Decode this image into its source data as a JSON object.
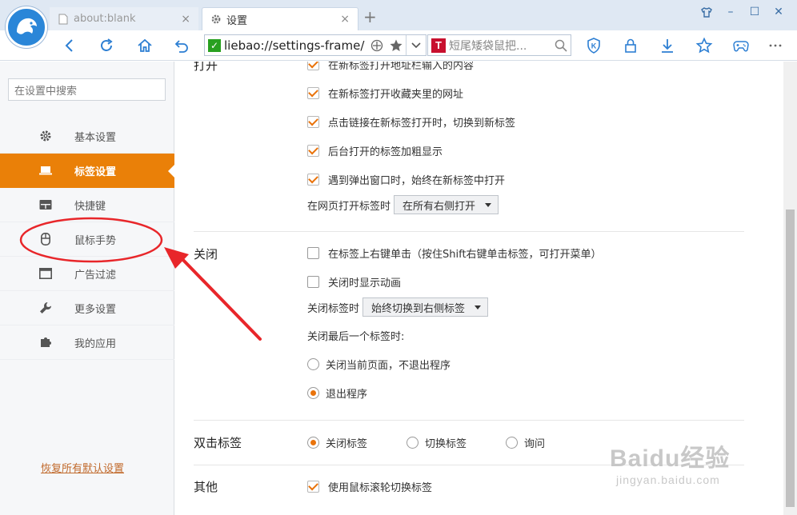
{
  "browser": {
    "tabs": [
      {
        "title": "about:blank",
        "close": "×"
      },
      {
        "title": "设置",
        "close": "×"
      }
    ],
    "new_tab": "+",
    "window_controls": [
      "shirt-icon",
      "minimize",
      "maximize",
      "close"
    ],
    "window_control_glyphs": [
      "",
      "–",
      "☐",
      "✕"
    ],
    "address": {
      "url": "liebao://settings-frame/",
      "secure_glyph": "✓"
    },
    "search": {
      "engine_letter": "T",
      "query": "短尾矮袋鼠把..."
    }
  },
  "sidebar": {
    "search_placeholder": "在设置中搜索",
    "items": [
      {
        "label": "基本设置",
        "icon": "gear-icon"
      },
      {
        "label": "标签设置",
        "icon": "laptop-icon",
        "active": true
      },
      {
        "label": "快捷键",
        "icon": "keyboard-icon"
      },
      {
        "label": "鼠标手势",
        "icon": "mouse-icon"
      },
      {
        "label": "广告过滤",
        "icon": "window-icon"
      },
      {
        "label": "更多设置",
        "icon": "wrench-icon"
      },
      {
        "label": "我的应用",
        "icon": "puzzle-icon"
      }
    ],
    "restore_label": "恢复所有默认设置"
  },
  "content": {
    "open": {
      "title": "打开",
      "options": [
        {
          "label": "在新标签打开地址栏输入的内容",
          "checked": true
        },
        {
          "label": "在新标签打开收藏夹里的网址",
          "checked": true
        },
        {
          "label": "点击链接在新标签打开时，切换到新标签",
          "checked": true
        },
        {
          "label": "后台打开的标签加粗显示",
          "checked": true
        },
        {
          "label": "遇到弹出窗口时，始终在新标签中打开",
          "checked": true
        }
      ],
      "webpage_open_label": "在网页打开标签时",
      "webpage_open_value": "在所有右侧打开"
    },
    "close": {
      "title": "关闭",
      "options": [
        {
          "label": "在标签上右键单击（按住Shift右键单击标签，可打开菜单）",
          "checked": false
        },
        {
          "label": "关闭时显示动画",
          "checked": false
        }
      ],
      "close_tab_label": "关闭标签时",
      "close_tab_value": "始终切换到右侧标签",
      "last_tab_label": "关闭最后一个标签时:",
      "last_tab_options": [
        {
          "label": "关闭当前页面，不退出程序",
          "selected": false
        },
        {
          "label": "退出程序",
          "selected": true
        }
      ]
    },
    "dblclick": {
      "title": "双击标签",
      "options": [
        {
          "label": "关闭标签",
          "selected": true
        },
        {
          "label": "切换标签",
          "selected": false
        },
        {
          "label": "询问",
          "selected": false
        }
      ]
    },
    "other": {
      "title": "其他",
      "options": [
        {
          "label": "使用鼠标滚轮切换标签",
          "checked": true
        }
      ]
    }
  },
  "watermark": {
    "line1": "Baidu经验",
    "line2": "jingyan.baidu.com"
  },
  "colors": {
    "accent": "#ea8008",
    "check": "#e9730b",
    "annotation": "#e8262a",
    "link": "#c16a2c"
  }
}
